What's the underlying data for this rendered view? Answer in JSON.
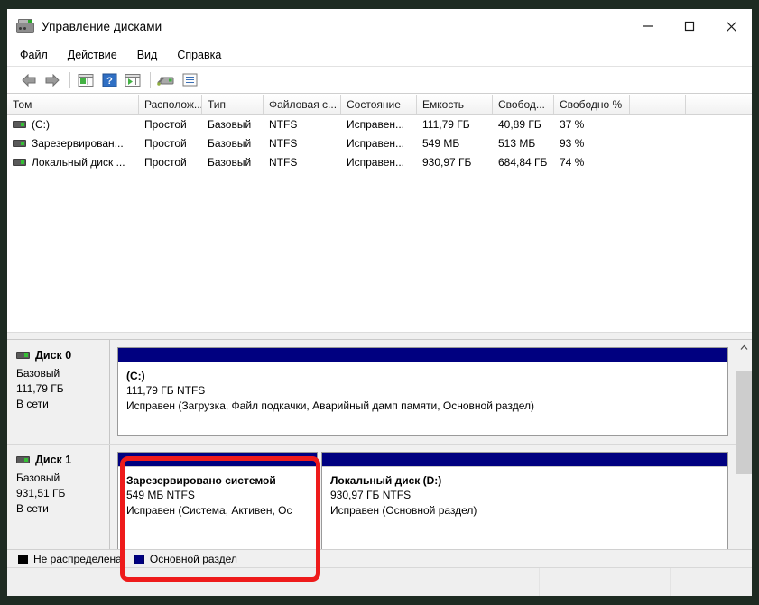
{
  "window": {
    "title": "Управление дисками",
    "icon": "disk-management-icon",
    "controls": {
      "minimize": "minimize-icon",
      "maximize": "maximize-icon",
      "close": "close-icon"
    }
  },
  "menu": {
    "items": [
      {
        "label": "Файл"
      },
      {
        "label": "Действие"
      },
      {
        "label": "Вид"
      },
      {
        "label": "Справка"
      }
    ]
  },
  "toolbar": {
    "buttons": [
      {
        "name": "back-icon"
      },
      {
        "name": "forward-icon"
      },
      {
        "name": "show-console-tree-icon"
      },
      {
        "name": "help-icon"
      },
      {
        "name": "show-action-pane-icon"
      },
      {
        "name": "rescan-disks-icon"
      },
      {
        "name": "properties-icon"
      }
    ]
  },
  "volumes": {
    "columns": [
      "Том",
      "Располож...",
      "Тип",
      "Файловая с...",
      "Состояние",
      "Емкость",
      "Свобод...",
      "Свободно %",
      ""
    ],
    "rows": [
      {
        "volume": "(C:)",
        "layout": "Простой",
        "type": "Базовый",
        "filesystem": "NTFS",
        "status": "Исправен...",
        "capacity": "111,79 ГБ",
        "free": "40,89 ГБ",
        "free_percent": "37 %",
        "extra": ""
      },
      {
        "volume": "Зарезервирован...",
        "layout": "Простой",
        "type": "Базовый",
        "filesystem": "NTFS",
        "status": "Исправен...",
        "capacity": "549 МБ",
        "free": "513 МБ",
        "free_percent": "93 %",
        "extra": ""
      },
      {
        "volume": "Локальный диск ...",
        "layout": "Простой",
        "type": "Базовый",
        "filesystem": "NTFS",
        "status": "Исправен...",
        "capacity": "930,97 ГБ",
        "free": "684,84 ГБ",
        "free_percent": "74 %",
        "extra": ""
      }
    ]
  },
  "disks": [
    {
      "name": "Диск 0",
      "type": "Базовый",
      "size": "111,79 ГБ",
      "state": "В сети",
      "partitions": [
        {
          "title": "(C:)",
          "size_fs": "111,79 ГБ NTFS",
          "status": "Исправен (Загрузка, Файл подкачки, Аварийный дамп памяти, Основной раздел)",
          "color": "#000080"
        }
      ]
    },
    {
      "name": "Диск 1",
      "type": "Базовый",
      "size": "931,51 ГБ",
      "state": "В сети",
      "partitions": [
        {
          "title": "Зарезервировано системой",
          "size_fs": "549 МБ NTFS",
          "status": "Исправен (Система, Активен, Ос",
          "color": "#000080",
          "highlighted": true
        },
        {
          "title": "Локальный диск  (D:)",
          "size_fs": "930,97 ГБ NTFS",
          "status": "Исправен (Основной раздел)",
          "color": "#000080"
        }
      ]
    }
  ],
  "legend": [
    {
      "label": "Не распределена",
      "color": "#000000"
    },
    {
      "label": "Основной раздел",
      "color": "#000080"
    }
  ],
  "annotation": {
    "color": "#ee1b1b",
    "target": "Зарезервировано системой"
  },
  "statusbar": {
    "segments": [
      "",
      "",
      "",
      ""
    ]
  }
}
